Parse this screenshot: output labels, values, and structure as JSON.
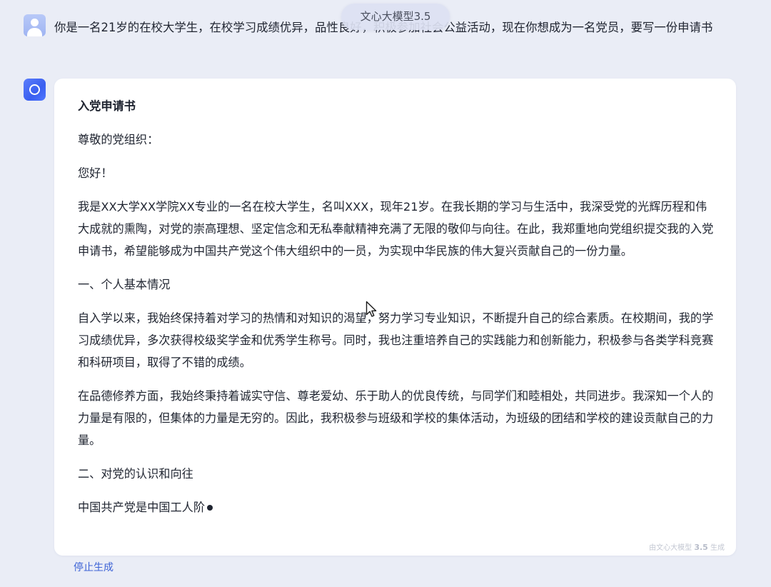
{
  "header": {
    "model_name": "文心大模型3.5"
  },
  "user": {
    "message": "你是一名21岁的在校大学生，在校学习成绩优异，品性良好，积极参加社会公益活动，现在你想成为一名党员，要写一份申请书"
  },
  "answer": {
    "title": "入党申请书",
    "salutation": "尊敬的党组织：",
    "greeting": "您好！",
    "paragraphs": [
      "我是XX大学XX学院XX专业的一名在校大学生，名叫XXX，现年21岁。在我长期的学习与生活中，我深受党的光辉历程和伟大成就的熏陶，对党的崇高理想、坚定信念和无私奉献精神充满了无限的敬仰与向往。在此，我郑重地向党组织提交我的入党申请书，希望能够成为中国共产党这个伟大组织中的一员，为实现中华民族的伟大复兴贡献自己的一份力量。",
      "一、个人基本情况",
      "自入学以来，我始终保持着对学习的热情和对知识的渴望，努力学习专业知识，不断提升自己的综合素质。在校期间，我的学习成绩优异，多次获得校级奖学金和优秀学生称号。同时，我也注重培养自己的实践能力和创新能力，积极参与各类学科竞赛和科研项目，取得了不错的成绩。",
      "在品德修养方面，我始终秉持着诚实守信、尊老爱幼、乐于助人的优良传统，与同学们和睦相处，共同进步。我深知一个人的力量是有限的，但集体的力量是无穷的。因此，我积极参与班级和学校的集体活动，为班级的团结和学校的建设贡献自己的力量。",
      "二、对党的认识和向往"
    ],
    "streaming_line": "中国共产党是中国工人阶",
    "watermark_prefix": "由文心大模型",
    "watermark_version": "3.5",
    "watermark_suffix": "生成"
  },
  "actions": {
    "stop_label": "停止生成"
  },
  "icons": {
    "user_avatar": "user-avatar-icon",
    "bot_avatar": "ernie-bot-icon",
    "cursor": "mouse-pointer-icon"
  },
  "colors": {
    "background": "#eaedf6",
    "card": "#ffffff",
    "accent": "#3d63d6",
    "text": "#1f2430"
  }
}
